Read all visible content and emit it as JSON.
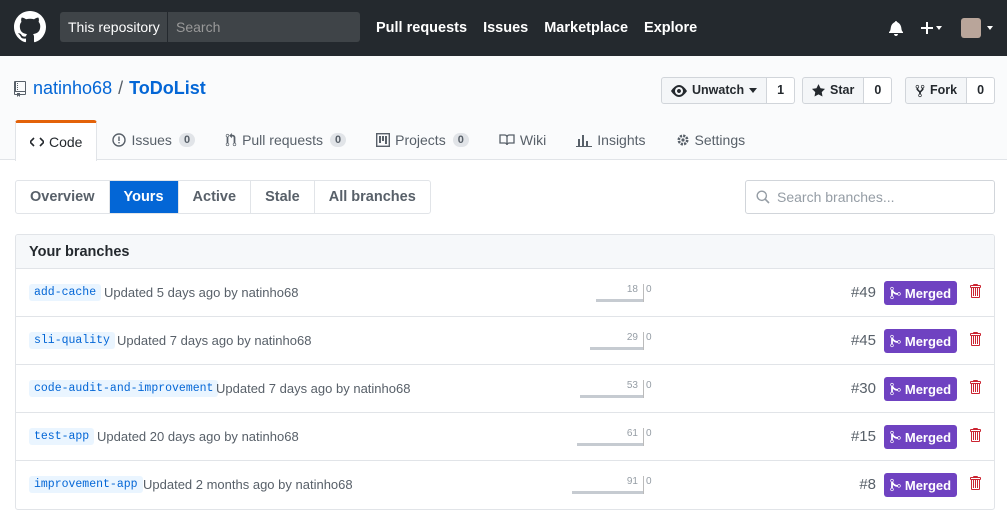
{
  "header": {
    "scope_label": "This repository",
    "search_placeholder": "Search",
    "nav": [
      "Pull requests",
      "Issues",
      "Marketplace",
      "Explore"
    ]
  },
  "repo": {
    "owner": "natinho68",
    "separator": "/",
    "name": "ToDoList",
    "watch_label": "Unwatch",
    "watch_count": "1",
    "star_label": "Star",
    "star_count": "0",
    "fork_label": "Fork",
    "fork_count": "0"
  },
  "tabs": [
    {
      "label": "Code",
      "count": null,
      "icon": "code-icon"
    },
    {
      "label": "Issues",
      "count": "0",
      "icon": "issue-icon"
    },
    {
      "label": "Pull requests",
      "count": "0",
      "icon": "pull-request-icon"
    },
    {
      "label": "Projects",
      "count": "0",
      "icon": "project-icon"
    },
    {
      "label": "Wiki",
      "count": null,
      "icon": "book-icon"
    },
    {
      "label": "Insights",
      "count": null,
      "icon": "graph-icon"
    },
    {
      "label": "Settings",
      "count": null,
      "icon": "gear-icon"
    }
  ],
  "subnav": [
    "Overview",
    "Yours",
    "Active",
    "Stale",
    "All branches"
  ],
  "branch_search_placeholder": "Search branches...",
  "box_title": "Your branches",
  "branches": [
    {
      "name": "add-cache",
      "updated": "Updated 5 days ago by",
      "author": "natinho68",
      "behind": "18",
      "ahead": "0",
      "pr": "#49",
      "status": "Merged"
    },
    {
      "name": "sli-quality",
      "updated": "Updated 7 days ago by",
      "author": "natinho68",
      "behind": "29",
      "ahead": "0",
      "pr": "#45",
      "status": "Merged"
    },
    {
      "name": "code-audit-and-improvement",
      "updated": "Updated 7 days ago by",
      "author": "natinho68",
      "behind": "53",
      "ahead": "0",
      "pr": "#30",
      "status": "Merged"
    },
    {
      "name": "test-app",
      "updated": "Updated 20 days ago by",
      "author": "natinho68",
      "behind": "61",
      "ahead": "0",
      "pr": "#15",
      "status": "Merged"
    },
    {
      "name": "improvement-app",
      "updated": "Updated 2 months ago by",
      "author": "natinho68",
      "behind": "91",
      "ahead": "0",
      "pr": "#8",
      "status": "Merged"
    }
  ],
  "colors": {
    "header_bg": "#24292e",
    "link": "#0366d6",
    "merged": "#6f42c1",
    "delete": "#cb2431",
    "tab_accent": "#e36209"
  }
}
